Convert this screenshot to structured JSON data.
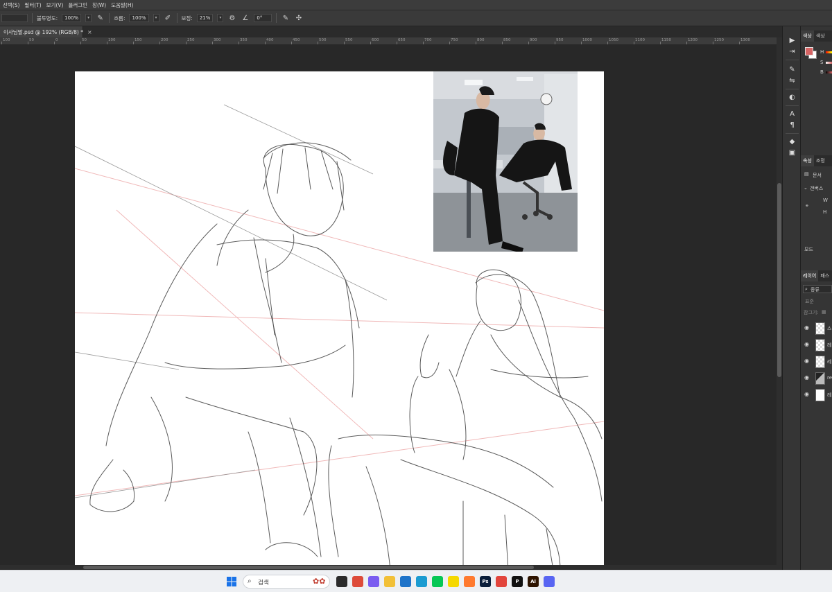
{
  "menu": [
    "선택(S)",
    "필터(T)",
    "보기(V)",
    "플러그인",
    "창(W)",
    "도움말(H)"
  ],
  "options": {
    "opacity_label": "불투명도:",
    "opacity_value": "100%",
    "flow_label": "흐름:",
    "flow_value": "100%",
    "smoothing_label": "보정:",
    "smoothing_value": "21%",
    "angle_value": "0°"
  },
  "document_tab": {
    "title": "이사님말.psd @ 192% (RGB/8) *",
    "close": "×"
  },
  "ruler": [
    "100",
    "50",
    "0",
    "50",
    "100",
    "150",
    "200",
    "250",
    "300",
    "350",
    "400",
    "450",
    "500",
    "550",
    "600",
    "650",
    "700",
    "750",
    "800",
    "850",
    "900",
    "950",
    "1000",
    "1050",
    "1100",
    "1150",
    "1200",
    "1250",
    "1300"
  ],
  "panels": {
    "color_tabs": [
      "색상",
      "색상"
    ],
    "color_labels": [
      "H",
      "S",
      "B"
    ],
    "colors": {
      "foreground": "#d66464",
      "background": "#ffffff"
    },
    "properties_tabs": [
      "속성",
      "조정"
    ],
    "properties_doc": "문서",
    "canvas_section": "갠버스",
    "w_label": "W",
    "h_label": "H",
    "mode_label": "모드",
    "layers_tabs": [
      "레이어",
      "패스"
    ],
    "layer_filter": "종류",
    "layer_blend": "표준",
    "layer_lock": "잠그기:",
    "layers": [
      {
        "name": "스",
        "thumb": "transparent"
      },
      {
        "name": "레",
        "thumb": "transparent"
      },
      {
        "name": "레",
        "thumb": "transparent"
      },
      {
        "name": "re",
        "thumb": "photo"
      },
      {
        "name": "레",
        "thumb": "white"
      }
    ]
  },
  "taskbar": {
    "search_label": "검색",
    "search_icon": "search-icon",
    "apps": [
      {
        "name": "file-explorer-icon",
        "label": "",
        "color": "#2b2b2b"
      },
      {
        "name": "chrome-icon",
        "label": "",
        "color": "#dd4b39"
      },
      {
        "name": "copilot-icon",
        "label": "",
        "color": "#7a5cf0"
      },
      {
        "name": "folder-icon",
        "label": "",
        "color": "#f2c037"
      },
      {
        "name": "store-icon",
        "label": "",
        "color": "#1e73c9"
      },
      {
        "name": "edge-icon",
        "label": "",
        "color": "#1b9bd1"
      },
      {
        "name": "line-icon",
        "label": "",
        "color": "#06c755"
      },
      {
        "name": "kakaotalk-icon",
        "label": "",
        "color": "#f5d800"
      },
      {
        "name": "app-icon",
        "label": "",
        "color": "#ff7a2f"
      },
      {
        "name": "photoshop-icon",
        "label": "Ps",
        "color": "#0a1e3a"
      },
      {
        "name": "app-red-icon",
        "label": "",
        "color": "#e2453c"
      },
      {
        "name": "picsart-icon",
        "label": "P",
        "color": "#111111"
      },
      {
        "name": "illustrator-icon",
        "label": "Ai",
        "color": "#2e1400"
      },
      {
        "name": "discord-icon",
        "label": "",
        "color": "#5865f2"
      }
    ]
  }
}
